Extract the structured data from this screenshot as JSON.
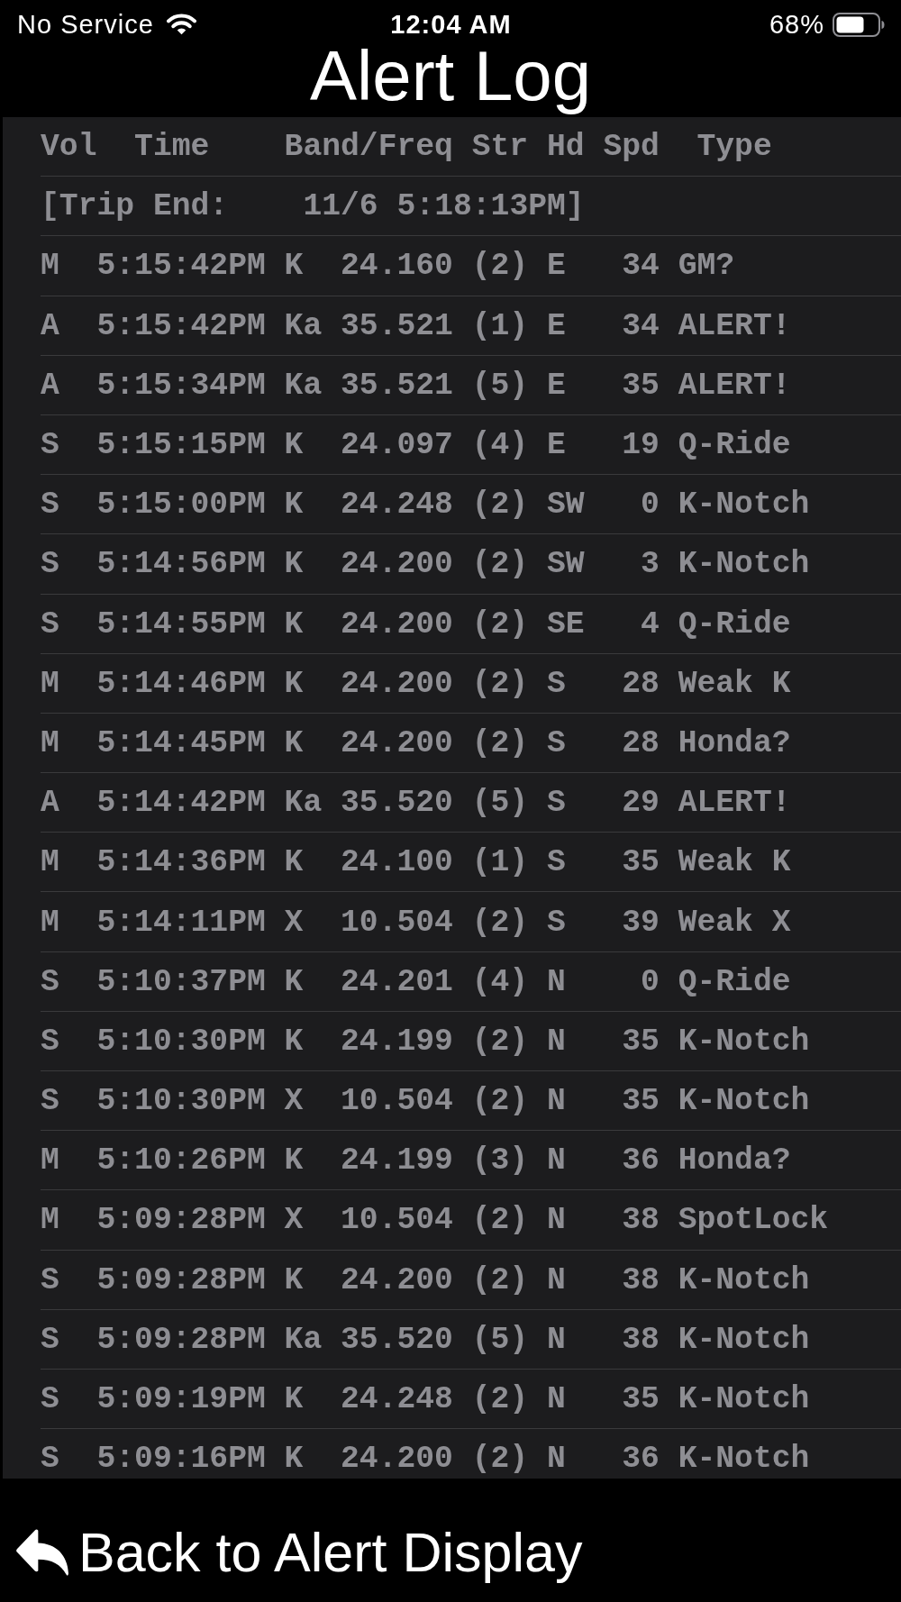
{
  "status_bar": {
    "carrier": "No Service",
    "time": "12:04 AM",
    "battery": "68%"
  },
  "title": "Alert Log",
  "log": {
    "columns": [
      "Vol",
      "Time",
      "Band/Freq",
      "Str",
      "Hd",
      "Spd",
      "Type"
    ],
    "trip_end": "[Trip End:    11/6 5:18:13PM]",
    "rows": [
      {
        "vol": "M",
        "time": "5:15:42PM",
        "band": "K",
        "freq": "24.160",
        "str": "(2)",
        "hd": "E",
        "spd": "34",
        "type": "GM?"
      },
      {
        "vol": "A",
        "time": "5:15:42PM",
        "band": "Ka",
        "freq": "35.521",
        "str": "(1)",
        "hd": "E",
        "spd": "34",
        "type": "ALERT!"
      },
      {
        "vol": "A",
        "time": "5:15:34PM",
        "band": "Ka",
        "freq": "35.521",
        "str": "(5)",
        "hd": "E",
        "spd": "35",
        "type": "ALERT!"
      },
      {
        "vol": "S",
        "time": "5:15:15PM",
        "band": "K",
        "freq": "24.097",
        "str": "(4)",
        "hd": "E",
        "spd": "19",
        "type": "Q-Ride"
      },
      {
        "vol": "S",
        "time": "5:15:00PM",
        "band": "K",
        "freq": "24.248",
        "str": "(2)",
        "hd": "SW",
        "spd": "0",
        "type": "K-Notch"
      },
      {
        "vol": "S",
        "time": "5:14:56PM",
        "band": "K",
        "freq": "24.200",
        "str": "(2)",
        "hd": "SW",
        "spd": "3",
        "type": "K-Notch"
      },
      {
        "vol": "S",
        "time": "5:14:55PM",
        "band": "K",
        "freq": "24.200",
        "str": "(2)",
        "hd": "SE",
        "spd": "4",
        "type": "Q-Ride"
      },
      {
        "vol": "M",
        "time": "5:14:46PM",
        "band": "K",
        "freq": "24.200",
        "str": "(2)",
        "hd": "S",
        "spd": "28",
        "type": "Weak K"
      },
      {
        "vol": "M",
        "time": "5:14:45PM",
        "band": "K",
        "freq": "24.200",
        "str": "(2)",
        "hd": "S",
        "spd": "28",
        "type": "Honda?"
      },
      {
        "vol": "A",
        "time": "5:14:42PM",
        "band": "Ka",
        "freq": "35.520",
        "str": "(5)",
        "hd": "S",
        "spd": "29",
        "type": "ALERT!"
      },
      {
        "vol": "M",
        "time": "5:14:36PM",
        "band": "K",
        "freq": "24.100",
        "str": "(1)",
        "hd": "S",
        "spd": "35",
        "type": "Weak K"
      },
      {
        "vol": "M",
        "time": "5:14:11PM",
        "band": "X",
        "freq": "10.504",
        "str": "(2)",
        "hd": "S",
        "spd": "39",
        "type": "Weak X"
      },
      {
        "vol": "S",
        "time": "5:10:37PM",
        "band": "K",
        "freq": "24.201",
        "str": "(4)",
        "hd": "N",
        "spd": "0",
        "type": "Q-Ride"
      },
      {
        "vol": "S",
        "time": "5:10:30PM",
        "band": "K",
        "freq": "24.199",
        "str": "(2)",
        "hd": "N",
        "spd": "35",
        "type": "K-Notch"
      },
      {
        "vol": "S",
        "time": "5:10:30PM",
        "band": "X",
        "freq": "10.504",
        "str": "(2)",
        "hd": "N",
        "spd": "35",
        "type": "K-Notch"
      },
      {
        "vol": "M",
        "time": "5:10:26PM",
        "band": "K",
        "freq": "24.199",
        "str": "(3)",
        "hd": "N",
        "spd": "36",
        "type": "Honda?"
      },
      {
        "vol": "M",
        "time": "5:09:28PM",
        "band": "X",
        "freq": "10.504",
        "str": "(2)",
        "hd": "N",
        "spd": "38",
        "type": "SpotLock"
      },
      {
        "vol": "S",
        "time": "5:09:28PM",
        "band": "K",
        "freq": "24.200",
        "str": "(2)",
        "hd": "N",
        "spd": "38",
        "type": "K-Notch"
      },
      {
        "vol": "S",
        "time": "5:09:28PM",
        "band": "Ka",
        "freq": "35.520",
        "str": "(5)",
        "hd": "N",
        "spd": "38",
        "type": "K-Notch"
      },
      {
        "vol": "S",
        "time": "5:09:19PM",
        "band": "K",
        "freq": "24.248",
        "str": "(2)",
        "hd": "N",
        "spd": "35",
        "type": "K-Notch"
      },
      {
        "vol": "S",
        "time": "5:09:16PM",
        "band": "K",
        "freq": "24.200",
        "str": "(2)",
        "hd": "N",
        "spd": "36",
        "type": "K-Notch"
      }
    ]
  },
  "back_button": {
    "label": "Back to Alert Display"
  }
}
